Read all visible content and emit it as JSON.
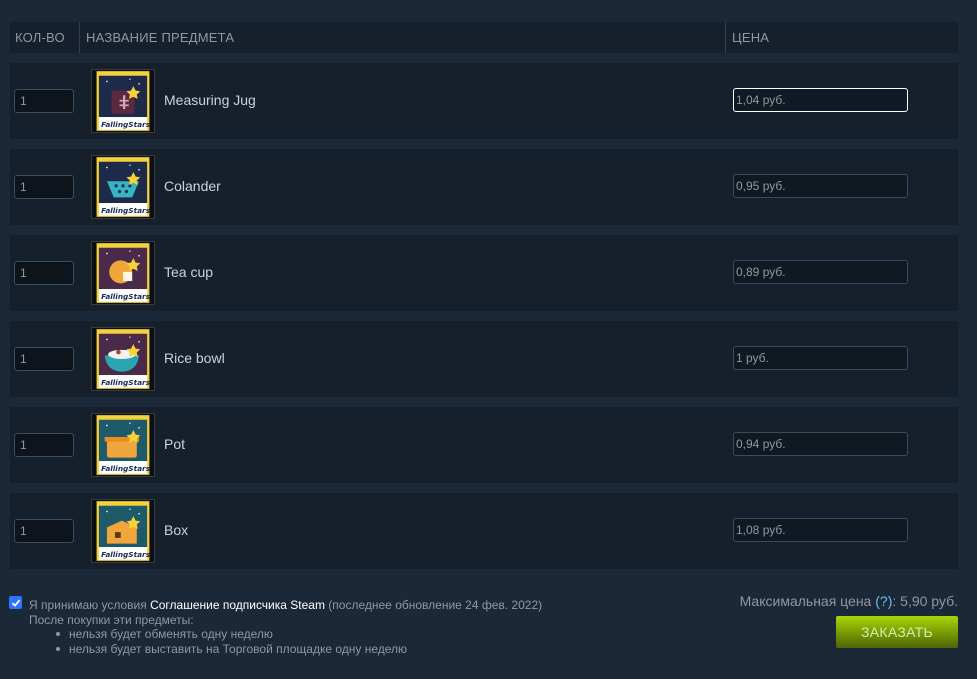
{
  "header": {
    "qty_label": "КОЛ-ВО",
    "name_label": "НАЗВАНИЕ ПРЕДМЕТА",
    "price_label": "ЦЕНА"
  },
  "items": [
    {
      "qty": "1",
      "name": "Measuring Jug",
      "price": "1,04 руб.",
      "art": "jug",
      "bg": "#1e2a4a",
      "focused": true
    },
    {
      "qty": "1",
      "name": "Colander",
      "price": "0,95 руб.",
      "art": "colander",
      "bg": "#1e2a4a",
      "focused": false
    },
    {
      "qty": "1",
      "name": "Tea cup",
      "price": "0,89 руб.",
      "art": "teacup",
      "bg": "#4a2a4a",
      "focused": false
    },
    {
      "qty": "1",
      "name": "Rice bowl",
      "price": "1 руб.",
      "art": "ricebowl",
      "bg": "#4a2a4a",
      "focused": false
    },
    {
      "qty": "1",
      "name": "Pot",
      "price": "0,94 руб.",
      "art": "pot",
      "bg": "#1f5a6a",
      "focused": false
    },
    {
      "qty": "1",
      "name": "Box",
      "price": "1,08 руб.",
      "art": "box",
      "bg": "#1f5a6a",
      "focused": false
    }
  ],
  "agreement": {
    "checked": true,
    "prefix": "Я принимаю условия ",
    "link": "Соглашение подписчика Steam",
    "suffix": " (последнее обновление 24 фев. 2022)",
    "after_purchase": "После покупки эти предметы:",
    "restrictions": [
      "нельзя будет обменять одну неделю",
      "нельзя будет выставить на Торговой площадке одну неделю"
    ]
  },
  "summary": {
    "max_price_label": "Максимальная цена",
    "help": "(?)",
    "max_price_value": ": 5,90 руб."
  },
  "order_button": "ЗАКАЗАТЬ",
  "card_logo": "FallingStars",
  "colors": {
    "background": "#1b2838",
    "row": "#16202d",
    "order_green": "#a4d007",
    "link_blue": "#66c0f4"
  }
}
